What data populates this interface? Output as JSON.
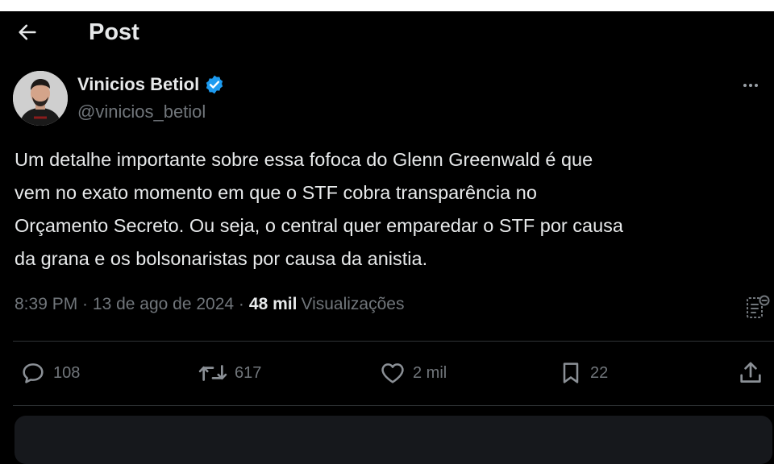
{
  "header": {
    "title": "Post",
    "back_icon": "arrow-left-icon"
  },
  "author": {
    "name": "Vinicios Betiol",
    "handle": "@vinicios_betiol",
    "verified": true,
    "verified_color": "#1d9bf0"
  },
  "post": {
    "text": "Um detalhe importante sobre essa fofoca do Glenn Greenwald é que\nvem no exato momento em que o STF cobra transparência no\nOrçamento Secreto. Ou seja, o central quer emparedar o STF por causa\nda grana e os bolsonaristas por causa da anistia.",
    "time": "8:39 PM",
    "date": "13 de ago de 2024",
    "views_count": "48 mil",
    "views_label": "Visualizações"
  },
  "actions": {
    "replies": "108",
    "reposts": "617",
    "likes": "2 mil",
    "bookmarks": "22"
  },
  "colors": {
    "background": "#000000",
    "text": "#e7e9ea",
    "muted": "#71767b",
    "divider": "#2f3336",
    "accent": "#1d9bf0"
  }
}
